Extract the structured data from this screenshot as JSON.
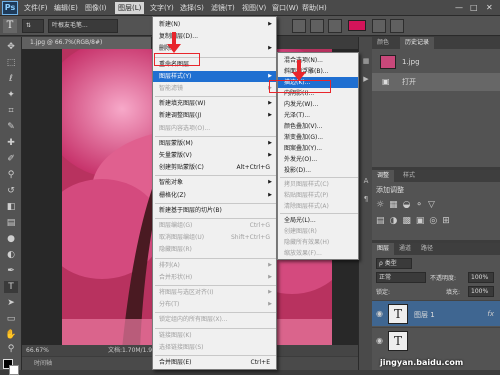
{
  "app": {
    "logo": "Ps"
  },
  "menubar": {
    "items": [
      "文件(F)",
      "编辑(E)",
      "图像(I)",
      "图层(L)",
      "文字(Y)",
      "选择(S)",
      "滤镜(T)",
      "视图(V)",
      "窗口(W)",
      "帮助(H)"
    ],
    "active_index": 3,
    "window_controls": [
      "—",
      "□",
      "✕"
    ]
  },
  "options": {
    "font_family": "叶根友毛笔...",
    "color": "#d4145a"
  },
  "document": {
    "tab_title": "1.jpg @ 66.7%(RGB/8#)",
    "zoom": "66.67%",
    "doc_info": "文档:1.70M/1.94M",
    "bottom_label": "时间轴"
  },
  "history": {
    "tabs": [
      "颜色",
      "历史记录"
    ],
    "active_tab": 1,
    "rows": [
      {
        "label": "1.jpg"
      },
      {
        "label": "打开"
      }
    ]
  },
  "adjustments": {
    "tabs": [
      "调整",
      "样式"
    ],
    "title": "添加调整"
  },
  "layers": {
    "tabs": [
      "图层",
      "通道",
      "路径"
    ],
    "kind_label": "类型",
    "blend_mode": "正常",
    "opacity_label": "不透明度:",
    "opacity_value": "100%",
    "lock_label": "锁定:",
    "fill_label": "填充:",
    "fill_value": "100%",
    "rows": [
      {
        "name": "图层 1",
        "thumb": "T",
        "fx": "fx",
        "selected": true
      },
      {
        "name": "",
        "thumb": "T",
        "fx": "",
        "selected": false
      }
    ]
  },
  "layer_menu": {
    "items": [
      {
        "label": "新建(N)",
        "shortcut": "",
        "arrow": true,
        "disabled": false
      },
      {
        "label": "复制图层(D)...",
        "shortcut": "",
        "arrow": false,
        "disabled": false
      },
      {
        "label": "删除",
        "shortcut": "",
        "arrow": true,
        "disabled": false
      },
      {
        "label": "重命名图层...",
        "shortcut": "",
        "arrow": false,
        "disabled": false
      },
      {
        "label": "图层样式(Y)",
        "shortcut": "",
        "arrow": true,
        "disabled": false,
        "highlight": true
      },
      {
        "label": "智能滤镜",
        "shortcut": "",
        "arrow": true,
        "disabled": true
      },
      {
        "label": "新建填充图层(W)",
        "shortcut": "",
        "arrow": true,
        "disabled": false
      },
      {
        "label": "新建调整图层(J)",
        "shortcut": "",
        "arrow": true,
        "disabled": false
      },
      {
        "label": "图层内容选项(O)...",
        "shortcut": "",
        "arrow": false,
        "disabled": true
      },
      {
        "label": "图层蒙版(M)",
        "shortcut": "",
        "arrow": true,
        "disabled": false
      },
      {
        "label": "矢量蒙版(V)",
        "shortcut": "",
        "arrow": true,
        "disabled": false
      },
      {
        "label": "创建剪贴蒙版(C)",
        "shortcut": "Alt+Ctrl+G",
        "arrow": false,
        "disabled": false
      },
      {
        "label": "智能对象",
        "shortcut": "",
        "arrow": true,
        "disabled": false
      },
      {
        "label": "栅格化(Z)",
        "shortcut": "",
        "arrow": true,
        "disabled": false
      },
      {
        "label": "新建基于图层的切片(B)",
        "shortcut": "",
        "arrow": false,
        "disabled": false
      },
      {
        "label": "图层编组(G)",
        "shortcut": "Ctrl+G",
        "arrow": false,
        "disabled": true
      },
      {
        "label": "取消图层编组(U)",
        "shortcut": "Shift+Ctrl+G",
        "arrow": false,
        "disabled": true
      },
      {
        "label": "隐藏图层(R)",
        "shortcut": "",
        "arrow": false,
        "disabled": true
      },
      {
        "label": "排列(A)",
        "shortcut": "",
        "arrow": true,
        "disabled": true
      },
      {
        "label": "合并形状(H)",
        "shortcut": "",
        "arrow": true,
        "disabled": true
      },
      {
        "label": "将图层与选区对齐(I)",
        "shortcut": "",
        "arrow": true,
        "disabled": true
      },
      {
        "label": "分布(T)",
        "shortcut": "",
        "arrow": true,
        "disabled": true
      },
      {
        "label": "锁定组内的所有图层(X)...",
        "shortcut": "",
        "arrow": false,
        "disabled": true
      },
      {
        "label": "链接图层(K)",
        "shortcut": "",
        "arrow": false,
        "disabled": true
      },
      {
        "label": "选择链接图层(S)",
        "shortcut": "",
        "arrow": false,
        "disabled": true
      },
      {
        "label": "合并图层(E)",
        "shortcut": "Ctrl+E",
        "arrow": false,
        "disabled": false
      }
    ]
  },
  "style_submenu": {
    "items": [
      {
        "label": "混合选项(N)...",
        "disabled": false
      },
      {
        "label": "斜面和浮雕(B)...",
        "disabled": false
      },
      {
        "label": "描边(K)...",
        "disabled": false,
        "highlight": true
      },
      {
        "label": "内阴影(I)...",
        "disabled": false
      },
      {
        "label": "内发光(W)...",
        "disabled": false
      },
      {
        "label": "光泽(T)...",
        "disabled": false
      },
      {
        "label": "颜色叠加(V)...",
        "disabled": false
      },
      {
        "label": "渐变叠加(G)...",
        "disabled": false
      },
      {
        "label": "图案叠加(Y)...",
        "disabled": false
      },
      {
        "label": "外发光(O)...",
        "disabled": false
      },
      {
        "label": "投影(D)...",
        "disabled": false
      },
      {
        "label": "拷贝图层样式(C)",
        "disabled": true
      },
      {
        "label": "粘贴图层样式(P)",
        "disabled": true
      },
      {
        "label": "清除图层样式(A)",
        "disabled": true
      },
      {
        "label": "全局光(L)...",
        "disabled": false
      },
      {
        "label": "创建图层(R)",
        "disabled": true
      },
      {
        "label": "隐藏所有效果(H)",
        "disabled": true
      },
      {
        "label": "缩放效果(F)...",
        "disabled": true
      }
    ]
  },
  "watermark": "jingyan.baidu.com"
}
